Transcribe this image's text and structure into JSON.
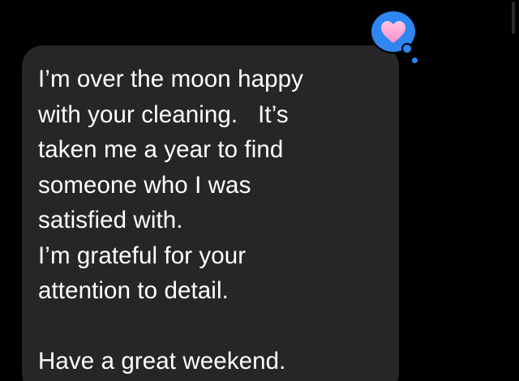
{
  "conversation": {
    "message": {
      "lines": [
        "I’m over the moon happy",
        "with your cleaning.   It’s",
        "taken me a year to find",
        "someone who I was",
        "satisfied with.",
        "I’m grateful for your",
        "attention to detail.",
        "",
        "Have a great weekend."
      ]
    },
    "tapback": {
      "icon": "heart-icon",
      "bubble_color": "#2f86f0",
      "heart_color": "#ff9fd1"
    }
  },
  "colors": {
    "background": "#000000",
    "bubble": "#262629",
    "text": "#ffffff"
  }
}
